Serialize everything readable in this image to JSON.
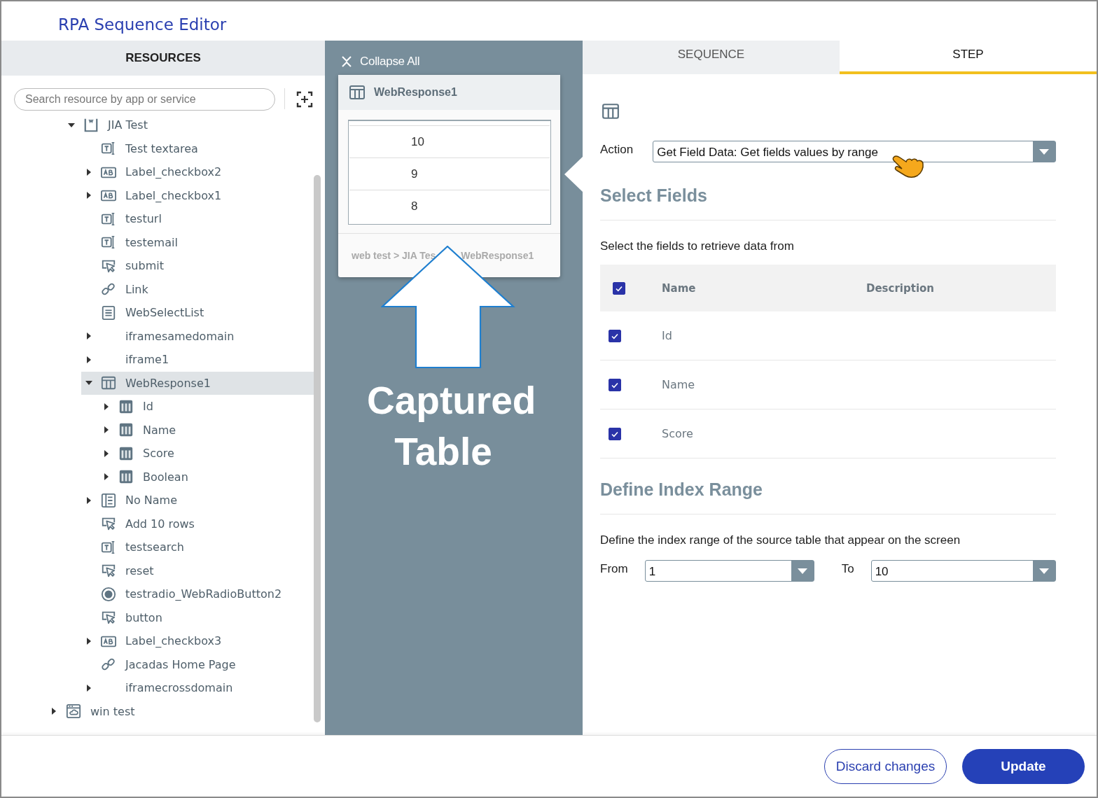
{
  "window": {
    "title": "RPA Sequence Editor"
  },
  "resources": {
    "header": "RESOURCES",
    "search": {
      "placeholder": "Search resource by app or service"
    },
    "tree": [
      {
        "children": [
          {
            "label": "JIA Test",
            "kind": "page",
            "expanded": true,
            "selected": false,
            "children": [
              {
                "label": "Test textarea",
                "kind": "textfield",
                "selected": false
              },
              {
                "label": "Label_checkbox2",
                "kind": "label",
                "expanded": false,
                "selected": false
              },
              {
                "label": "Label_checkbox1",
                "kind": "label",
                "expanded": false,
                "selected": false
              },
              {
                "label": "testurl",
                "kind": "textfield",
                "selected": false
              },
              {
                "label": "testemail",
                "kind": "textfield",
                "selected": false
              },
              {
                "label": "submit",
                "kind": "button",
                "selected": false
              },
              {
                "label": "Link",
                "kind": "link",
                "selected": false
              },
              {
                "label": "WebSelectList",
                "kind": "list",
                "selected": false
              },
              {
                "label": "iframesamedomain",
                "kind": "frame",
                "expanded": false,
                "selected": false
              },
              {
                "label": "iframe1",
                "kind": "frame",
                "expanded": false,
                "selected": false
              },
              {
                "label": "WebResponse1",
                "kind": "table",
                "expanded": true,
                "selected": true,
                "children": [
                  {
                    "label": "Id",
                    "kind": "column",
                    "expanded": false,
                    "selected": false
                  },
                  {
                    "label": "Name",
                    "kind": "column",
                    "expanded": false,
                    "selected": false
                  },
                  {
                    "label": "Score",
                    "kind": "column",
                    "expanded": false,
                    "selected": false
                  },
                  {
                    "label": "Boolean",
                    "kind": "column",
                    "expanded": false,
                    "selected": false
                  }
                ]
              },
              {
                "label": "No Name",
                "kind": "form",
                "expanded": false,
                "selected": false
              },
              {
                "label": "Add 10 rows",
                "kind": "button",
                "selected": false
              },
              {
                "label": "testsearch",
                "kind": "textfield",
                "selected": false
              },
              {
                "label": "reset",
                "kind": "button",
                "selected": false
              },
              {
                "label": "testradio_WebRadioButton2",
                "kind": "radio",
                "selected": false
              },
              {
                "label": "button",
                "kind": "button",
                "selected": false
              },
              {
                "label": "Label_checkbox3",
                "kind": "label",
                "expanded": false,
                "selected": false
              },
              {
                "label": "Jacadas Home Page",
                "kind": "link",
                "selected": false
              },
              {
                "label": "iframecrossdomain",
                "kind": "frame",
                "expanded": false,
                "selected": false
              }
            ]
          }
        ]
      },
      {
        "label": "win test",
        "kind": "window",
        "expanded": false,
        "selected": false
      }
    ]
  },
  "preview": {
    "collapse_all": "Collapse All",
    "card": {
      "title": "WebResponse1",
      "rows": [
        "10",
        "9",
        "8"
      ],
      "breadcrumb": [
        "web test > JIA Tes",
        "WebResponse1"
      ]
    }
  },
  "annotation": {
    "label": "Captured Table"
  },
  "tabs": [
    {
      "label": "SEQUENCE",
      "selected": false
    },
    {
      "label": "STEP",
      "selected": true
    }
  ],
  "step": {
    "action": {
      "label": "Action",
      "value": "Get Field Data: Get fields values by range"
    },
    "select_fields": {
      "heading": "Select Fields",
      "hint": "Select the fields to retrieve data from",
      "all_checked": true,
      "columns": [
        "Name",
        "Description"
      ],
      "rows": [
        {
          "name": "Id",
          "checked": true
        },
        {
          "name": "Name",
          "checked": true
        },
        {
          "name": "Score",
          "checked": true
        }
      ]
    },
    "index_range": {
      "heading": "Define Index Range",
      "hint": "Define the index range of the source table that appear on the screen",
      "from": {
        "label": "From",
        "value": "1"
      },
      "to": {
        "label": "To",
        "value": "10"
      }
    }
  },
  "footer": {
    "buttons": [
      {
        "label": "Discard changes",
        "kind": "secondary"
      },
      {
        "label": "Update",
        "kind": "primary"
      }
    ]
  }
}
